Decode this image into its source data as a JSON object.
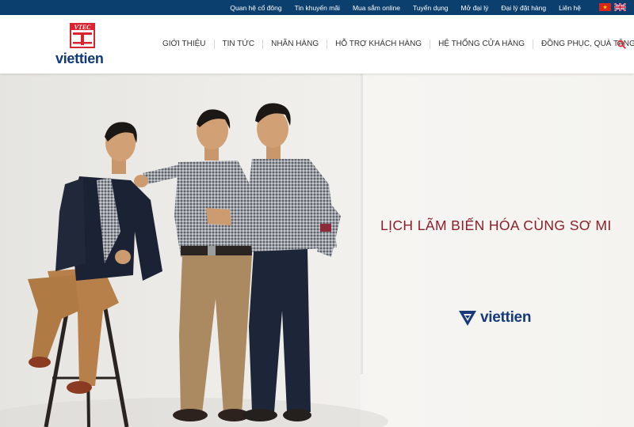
{
  "topbar": {
    "links": [
      "Quan hệ cổ đông",
      "Tin khuyến mãi",
      "Mua sắm online",
      "Tuyển dụng",
      "Mở đại lý",
      "Đại lý đặt hàng",
      "Liên hệ"
    ],
    "languages": [
      "vietnamese-flag",
      "english-flag"
    ]
  },
  "header": {
    "logo_mark_text": "VTEC",
    "logo_text": "viettien",
    "nav": [
      "GIỚI THIỆU",
      "TIN TỨC",
      "NHÃN HÀNG",
      "HỖ TRỢ KHÁCH HÀNG",
      "HỆ THỐNG CỬA HÀNG",
      "ĐỒNG PHỤC, QUÀ TẶNG"
    ],
    "search_icon": "search-icon"
  },
  "hero": {
    "tagline": "LỊCH LÃM BIẾN HÓA CÙNG SƠ MI",
    "brand_text": "viettien"
  },
  "colors": {
    "topbar": "#0b3f6e",
    "tagline": "#8b1e2b",
    "brand": "#163a7a",
    "logo_red": "#d9232e"
  }
}
